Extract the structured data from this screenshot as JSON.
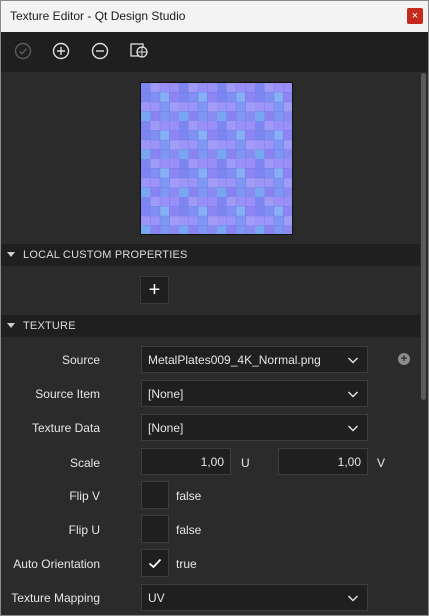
{
  "window": {
    "title": "Texture Editor - Qt Design Studio",
    "close_glyph": "×"
  },
  "toolbar": {
    "icons": [
      "apply-icon",
      "zoom-in-icon",
      "zoom-out-icon",
      "background-icon"
    ]
  },
  "sections": {
    "local_custom_properties": "LOCAL CUSTOM PROPERTIES",
    "texture": "TEXTURE",
    "add_property_glyph": "+"
  },
  "properties": {
    "source": {
      "label": "Source",
      "value": "MetalPlates009_4K_Normal.png"
    },
    "source_item": {
      "label": "Source Item",
      "value": "[None]"
    },
    "texture_data": {
      "label": "Texture Data",
      "value": "[None]"
    },
    "scale": {
      "label": "Scale",
      "u_value": "1,00",
      "u_unit": "U",
      "v_value": "1,00",
      "v_unit": "V"
    },
    "flip_v": {
      "label": "Flip V",
      "value": "false"
    },
    "flip_u": {
      "label": "Flip U",
      "value": "false"
    },
    "auto_orientation": {
      "label": "Auto Orientation",
      "value": "true"
    },
    "texture_mapping": {
      "label": "Texture Mapping",
      "value": "UV"
    }
  },
  "add_source_glyph": "+",
  "colors": {
    "panel_bg": "#2b2b2b",
    "field_bg": "#1f1f1f",
    "close_red": "#c42b1c",
    "normal_map_blue": "#8a8cf2"
  }
}
